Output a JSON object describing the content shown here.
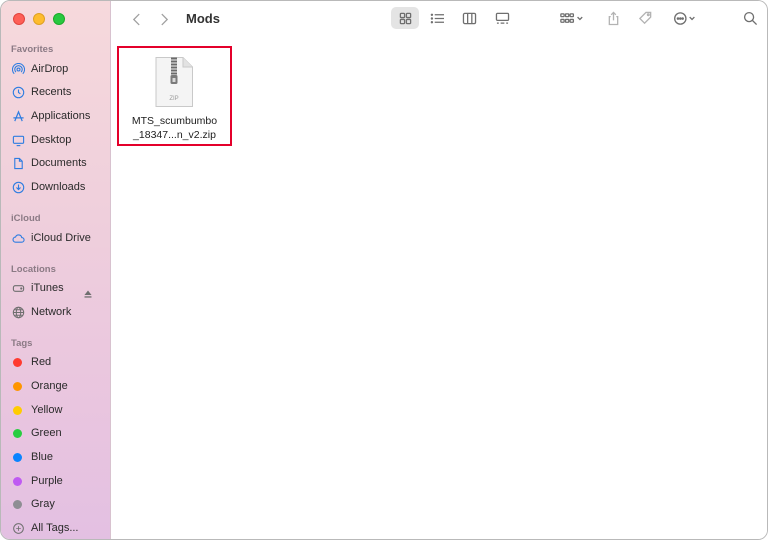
{
  "window": {
    "title": "Mods"
  },
  "sidebar": {
    "favorites_title": "Favorites",
    "favorites": [
      {
        "label": "AirDrop",
        "icon": "airdrop-icon"
      },
      {
        "label": "Recents",
        "icon": "clock-icon"
      },
      {
        "label": "Applications",
        "icon": "applications-icon"
      },
      {
        "label": "Desktop",
        "icon": "desktop-icon"
      },
      {
        "label": "Documents",
        "icon": "document-icon"
      },
      {
        "label": "Downloads",
        "icon": "download-icon"
      }
    ],
    "icloud_title": "iCloud",
    "icloud": [
      {
        "label": "iCloud Drive",
        "icon": "cloud-icon"
      }
    ],
    "locations_title": "Locations",
    "locations": [
      {
        "label": "iTunes",
        "icon": "disk-icon"
      },
      {
        "label": "Network",
        "icon": "globe-icon"
      }
    ],
    "tags_title": "Tags",
    "tags": [
      {
        "label": "Red",
        "color": "#ff3b30"
      },
      {
        "label": "Orange",
        "color": "#ff9500"
      },
      {
        "label": "Yellow",
        "color": "#ffcc00"
      },
      {
        "label": "Green",
        "color": "#28cd41"
      },
      {
        "label": "Blue",
        "color": "#0a84ff"
      },
      {
        "label": "Purple",
        "color": "#bf5af2"
      },
      {
        "label": "Gray",
        "color": "#8e8e93"
      }
    ],
    "all_tags": "All Tags..."
  },
  "content": {
    "files": [
      {
        "name_line1": "MTS_scumbumbo",
        "name_line2": "_18347...n_v2.zip",
        "icon_label": "ZIP",
        "selected": true
      }
    ]
  },
  "colors": {
    "accent": "#0a84ff",
    "highlight": "#e4002b"
  }
}
